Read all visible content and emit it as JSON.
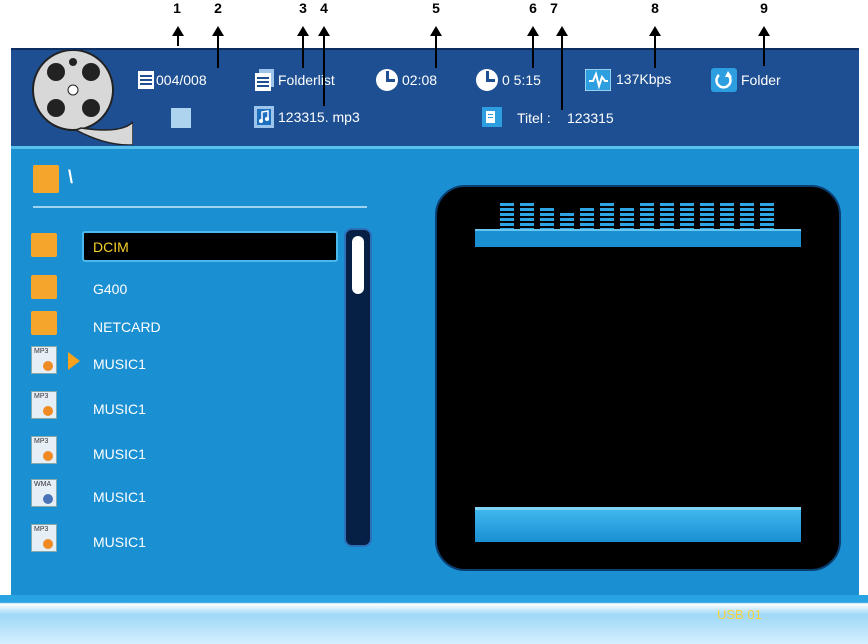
{
  "callouts": [
    "1",
    "2",
    "3",
    "4",
    "5",
    "6",
    "7",
    "8",
    "9"
  ],
  "header": {
    "track_counter": "004/008",
    "mode_label": "Folderlist",
    "elapsed_time": "02:08",
    "total_time": "0 5:15",
    "bitrate": "137Kbps",
    "repeat_mode": "Folder",
    "file_name": "123315. mp3",
    "title_label": "Titel :",
    "title_value": "123315"
  },
  "browser": {
    "path": "\\",
    "items": [
      {
        "label": "DCIM",
        "type": "folder",
        "selected": true
      },
      {
        "label": "G400",
        "type": "folder"
      },
      {
        "label": "NETCARD",
        "type": "folder"
      },
      {
        "label": "MUSIC1",
        "type": "mp3",
        "playing": true
      },
      {
        "label": "MUSIC1",
        "type": "mp3"
      },
      {
        "label": "MUSIC1",
        "type": "mp3"
      },
      {
        "label": "MUSIC1",
        "type": "wma"
      },
      {
        "label": "MUSIC1",
        "type": "mp3"
      }
    ],
    "icon_tags": {
      "mp3": "MP3",
      "wma": "WMA"
    }
  },
  "equalizer_levels": [
    0.8,
    0.9,
    0.7,
    0.5,
    0.7,
    0.9,
    0.7,
    0.9,
    0.9,
    0.9,
    0.9,
    0.9,
    0.9,
    0.9
  ],
  "footer": {
    "source": "USB 01"
  },
  "colors": {
    "selected_text": "#f7d12a",
    "footer_text": "#f4d23c",
    "header_bg": "#1d4f92",
    "panel_bg": "#1a8fd2"
  }
}
